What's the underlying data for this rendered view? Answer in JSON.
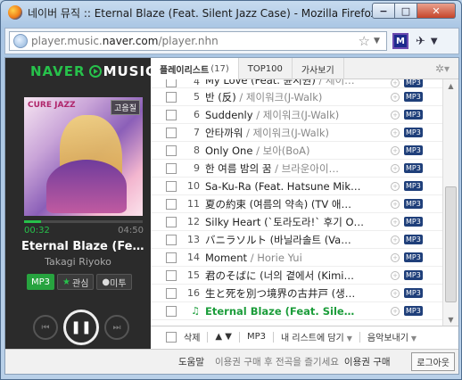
{
  "window": {
    "title": "네이버 뮤직 :: Eternal Blaze (Feat. Silent Jazz Case) - Mozilla Firefox",
    "min_label": "−",
    "max_label": "□",
    "close_label": "✕"
  },
  "address": {
    "url_prefix": "player.music.",
    "url_domain": "naver.com",
    "url_path": "/player.nhn",
    "ext_label": "M"
  },
  "player": {
    "logo_naver": "NAVER",
    "logo_music": "MUSIC",
    "cover_tag": "CURE JAZZ",
    "hq_label": "고음질",
    "progress_fraction": 0.14,
    "time_current": "00:32",
    "time_total": "04:50",
    "song_title": "Eternal Blaze (Fe…",
    "artist": "Takagi Riyoko",
    "btn_mp3": "MP3",
    "btn_like": "관심",
    "btn_mitu": "미투",
    "prev_label": "⏮",
    "pause_label": "❚❚",
    "next_label": "⏭",
    "volume_fraction": 0.55
  },
  "tabs": [
    {
      "label": "플레이리스트",
      "count": "(17)"
    },
    {
      "label": "TOP100"
    },
    {
      "label": "가사보기"
    }
  ],
  "rows": [
    {
      "num": "4",
      "title": "My Love (Feat. 윤지원)",
      "artist": "제이…"
    },
    {
      "num": "5",
      "title": "반 (反)",
      "artist": "제이워크(J-Walk)"
    },
    {
      "num": "6",
      "title": "Suddenly",
      "artist": "제이워크(J-Walk)"
    },
    {
      "num": "7",
      "title": "안타까워",
      "artist": "제이워크(J-Walk)"
    },
    {
      "num": "8",
      "title": "Only One",
      "artist": "보아(BoA)"
    },
    {
      "num": "9",
      "title": "한 여름 밤의 꿈",
      "artist": "브라운아이…"
    },
    {
      "num": "10",
      "title": "Sa-Ku-Ra (Feat. Hatsune Mik…",
      "artist": ""
    },
    {
      "num": "11",
      "title": "夏の約束 (여름의 약속) (TV 애…",
      "artist": ""
    },
    {
      "num": "12",
      "title": "Silky Heart (`토라도라!` 후기 O…",
      "artist": ""
    },
    {
      "num": "13",
      "title": "バニラソルト (바닐라솔트 (Va…",
      "artist": ""
    },
    {
      "num": "14",
      "title": "Moment",
      "artist": "Horie Yui"
    },
    {
      "num": "15",
      "title": "君のそばに (너의 곁에서 (Kimi…",
      "artist": ""
    },
    {
      "num": "16",
      "title": "生と死を別つ境界の古井戸 (생…",
      "artist": ""
    },
    {
      "num": "♫",
      "title": "Eternal Blaze (Feat. Sile…",
      "artist": "",
      "playing": true
    }
  ],
  "mp3_badge": "MP3",
  "toolbar": {
    "delete": "삭제",
    "arrows": "▲ ▼",
    "mp3": "MP3",
    "add_to_list": "내 리스트에 담기",
    "music_send": "음악보내기"
  },
  "footer": {
    "help": "도움말",
    "note": "이용권 구매 후 전곡을 즐기세요",
    "buy": "이용권 구매",
    "logout": "로그아웃"
  }
}
